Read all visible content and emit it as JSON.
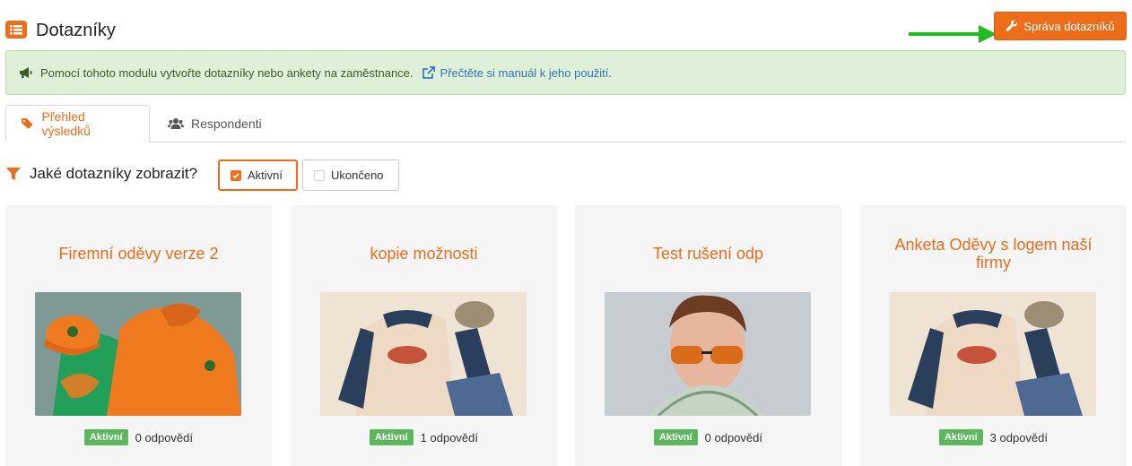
{
  "header": {
    "title": "Dotazníky",
    "manage_button": "Správa dotazníků",
    "accent": "#ee6d1a"
  },
  "alert": {
    "text": "Pomocí tohoto modulu vytvořte dotazníky nebo ankety na zaměstnance.",
    "link": "Přečtěte si manuál k jeho použití."
  },
  "tabs": [
    {
      "label": "Přehled výsledků",
      "icon": "tags-icon",
      "active": true
    },
    {
      "label": "Respondenti",
      "icon": "users-icon",
      "active": false
    }
  ],
  "filter": {
    "label": "Jaké dotazníky zobrazit?",
    "options": [
      {
        "label": "Aktivní",
        "checked": true
      },
      {
        "label": "Ukončeno",
        "checked": false
      }
    ]
  },
  "cards": [
    {
      "title": "Firemní oděvy verze 2",
      "status": "Aktivní",
      "responses": "0 odpovědí",
      "image": "orange-hoodie-cap-photo"
    },
    {
      "title": "kopie možnosti",
      "status": "Aktivní",
      "responses": "1 odpovědí",
      "image": "raglan-shirt-jeans-photo"
    },
    {
      "title": "Test rušení odp",
      "status": "Aktivní",
      "responses": "0 odpovědí",
      "image": "man-sunglasses-money-photo"
    },
    {
      "title": "Anketa Oděvy s logem naší firmy",
      "status": "Aktivní",
      "responses": "3 odpovědí",
      "image": "raglan-shirt-jeans-photo"
    }
  ]
}
